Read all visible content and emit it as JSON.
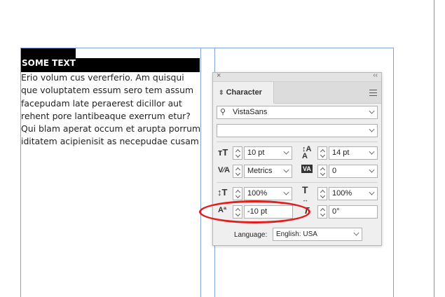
{
  "document": {
    "heading": "SOME TEXT",
    "body_lines": [
      "Erio volum cus vererferio. Am quisqui",
      "que voluptatem essum sero tem assum",
      "facepudam late peraerest dicillor aut",
      "rehent pore lantibeaque exerrum etur?",
      "Qui blam aperat occum et arupta porrum",
      "iditatem acipienisit as necepudae cusam"
    ]
  },
  "panel": {
    "close": "×",
    "collapse": "‹‹",
    "tab_label": "Character",
    "font_family": "VistaSans",
    "font_style": "",
    "font_size": "10 pt",
    "leading": "14 pt",
    "kerning": "Metrics",
    "tracking": "0",
    "vertical_scale": "100%",
    "horizontal_scale": "100%",
    "baseline_shift": "-10 pt",
    "skew": "0°",
    "language_label": "Language:",
    "language_value": "English: USA"
  },
  "colors": {
    "highlight": "#e31c1c",
    "guide": "#7fa6d8"
  }
}
